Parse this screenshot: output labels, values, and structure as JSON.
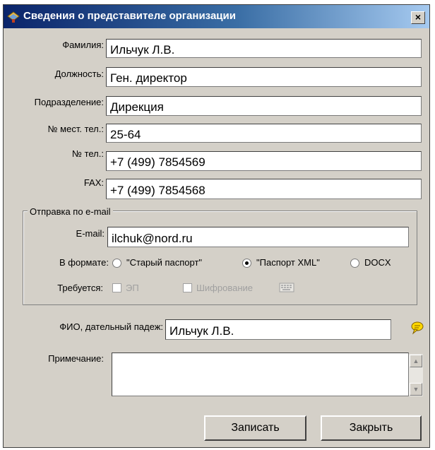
{
  "window": {
    "title": "Сведения о представителе организации",
    "close_label": "×"
  },
  "form": {
    "lastname_label": "Фамилия:",
    "lastname_value": "Ильчук Л.В.",
    "position_label": "Должность:",
    "position_value": "Ген. директор",
    "department_label": "Подразделение:",
    "department_value": "Дирекция",
    "local_phone_label": "№ мест. тел.:",
    "local_phone_value": "25-64",
    "phone_label": "№ тел.:",
    "phone_value": "+7 (499) 7854569",
    "fax_label": "FAX:",
    "fax_value": "+7 (499) 7854568"
  },
  "email_group": {
    "legend": "Отправка по e-mail",
    "email_label": "E-mail:",
    "email_value": "ilchuk@nord.ru",
    "format_label": "В формате:",
    "format_options": [
      {
        "label": "\"Старый паспорт\"",
        "selected": false
      },
      {
        "label": "\"Паспорт XML\"",
        "selected": true
      },
      {
        "label": "DOCX",
        "selected": false
      }
    ],
    "required_label": "Требуется:",
    "ep_label": "ЭП",
    "encryption_label": "Шифрование"
  },
  "dative": {
    "label": "ФИО, дательный падеж:",
    "value": "Ильчук Л.В."
  },
  "note": {
    "label": "Примечание:",
    "value": ""
  },
  "buttons": {
    "save": "Записать",
    "close": "Закрыть"
  },
  "colors": {
    "title_bar_start": "#0a246a",
    "title_bar_end": "#a6caf0",
    "window_bg": "#d4d0c8",
    "comment_icon": "#ffd800"
  },
  "icons": [
    "app-icon",
    "close-icon",
    "keyboard-icon",
    "speech-bubble-icon",
    "scroll-up-icon",
    "scroll-down-icon"
  ]
}
